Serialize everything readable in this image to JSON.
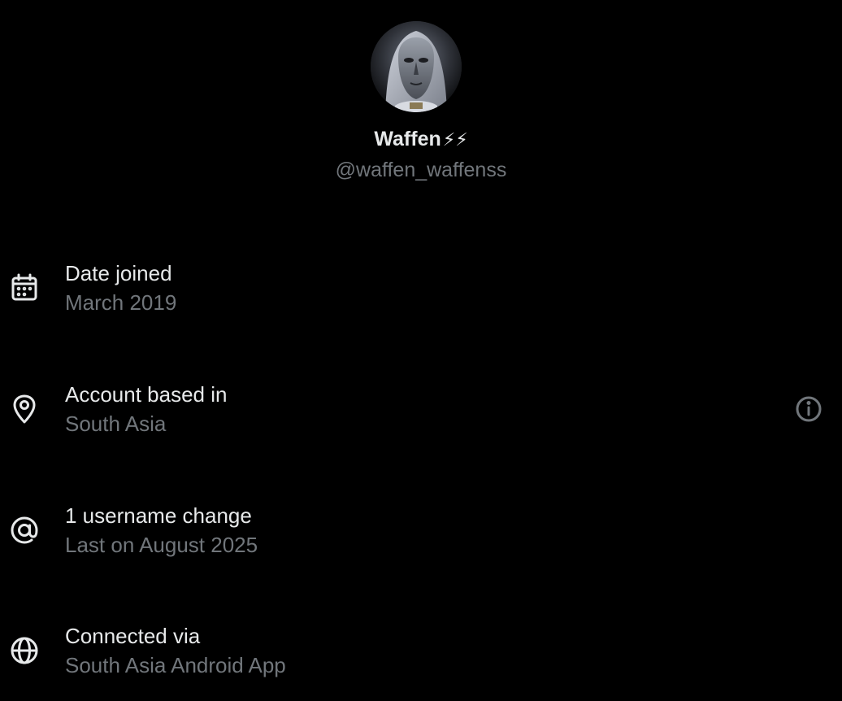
{
  "profile": {
    "display_name": "Waffen",
    "name_emoji": "⚡⚡",
    "handle": "@waffen_waffenss",
    "avatar_icon": "masked-figure-avatar"
  },
  "details": [
    {
      "icon": "calendar-icon",
      "title": "Date joined",
      "value": "March 2019"
    },
    {
      "icon": "location-pin-icon",
      "title": "Account based in",
      "value": "South Asia",
      "action_icon": "info-icon"
    },
    {
      "icon": "at-sign-icon",
      "title": "1 username change",
      "value": "Last on August 2025"
    },
    {
      "icon": "globe-icon",
      "title": "Connected via",
      "value": "South Asia Android App"
    }
  ],
  "colors": {
    "background": "#000000",
    "primary_text": "#e7e9ea",
    "secondary_text": "#71767b"
  }
}
